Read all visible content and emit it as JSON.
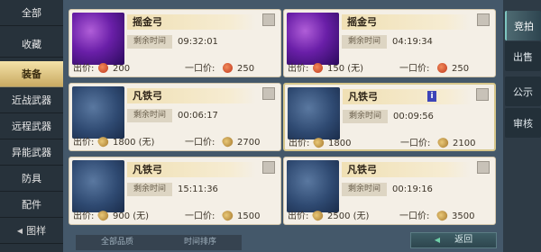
{
  "sidebar": {
    "items": [
      {
        "label": "全部"
      },
      {
        "label": "收藏"
      },
      {
        "label": "装备"
      },
      {
        "label": "近战武器"
      },
      {
        "label": "远程武器"
      },
      {
        "label": "异能武器"
      },
      {
        "label": "防具"
      },
      {
        "label": "配件"
      },
      {
        "label": "图样"
      }
    ],
    "active_label": "装备"
  },
  "cards": [
    {
      "name": "摇金弓",
      "time_label": "剩余时间",
      "time": "09:32:01",
      "bid_label": "出价:",
      "bid": "200",
      "buyout_label": "一口价:",
      "buyout": "250",
      "currency": "red-coin-icon",
      "thumb": "gold"
    },
    {
      "name": "摇金弓",
      "time_label": "剩余时间",
      "time": "04:19:34",
      "bid_label": "出价:",
      "bid": "150 (无)",
      "buyout_label": "一口价:",
      "buyout": "250",
      "currency": "red-coin-icon",
      "thumb": "gold"
    },
    {
      "name": "凡铁弓",
      "time_label": "剩余时间",
      "time": "00:06:17",
      "bid_label": "出价:",
      "bid": "1800 (无)",
      "buyout_label": "一口价:",
      "buyout": "2700",
      "currency": "gold-leaf-icon",
      "thumb": "iron"
    },
    {
      "name": "凡铁弓",
      "time_label": "剩余时间",
      "time": "00:09:56",
      "bid_label": "出价:",
      "bid": "1800",
      "buyout_label": "一口价:",
      "buyout": "2100",
      "currency": "gold-leaf-icon",
      "thumb": "iron"
    },
    {
      "name": "凡铁弓",
      "time_label": "剩余时间",
      "time": "15:11:36",
      "bid_label": "出价:",
      "bid": "900 (无)",
      "buyout_label": "一口价:",
      "buyout": "1500",
      "currency": "gold-leaf-icon",
      "thumb": "iron"
    },
    {
      "name": "凡铁弓",
      "time_label": "剩余时间",
      "time": "00:19:16",
      "bid_label": "出价:",
      "bid": "2500 (无)",
      "buyout_label": "一口价:",
      "buyout": "3500",
      "currency": "gold-leaf-icon",
      "thumb": "iron"
    }
  ],
  "bottom": {
    "filter_label": "全部品质",
    "sort_label": "时间排序",
    "back_label": "返回"
  },
  "right_tabs": [
    {
      "label": "竞拍"
    },
    {
      "label": "出售"
    },
    {
      "label": "公示"
    },
    {
      "label": "审核"
    }
  ],
  "colors": {
    "active_tab": "#c9aa62",
    "card_bg": "#f4efe6",
    "panel_bg": "#44586a"
  }
}
